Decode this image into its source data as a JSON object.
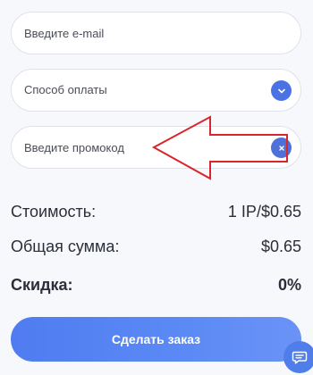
{
  "form": {
    "email_placeholder": "Введите e-mail",
    "payment_method_label": "Способ оплаты",
    "promo_placeholder": "Введите промокод"
  },
  "summary": {
    "cost_label": "Стоимость:",
    "cost_value": "1 IP/$0.65",
    "total_label": "Общая сумма:",
    "total_value": "$0.65",
    "discount_label": "Скидка:",
    "discount_value": "0%"
  },
  "actions": {
    "order_button_label": "Сделать заказ"
  },
  "icons": {
    "dropdown": "chevron-down-icon",
    "clear": "close-icon",
    "chat": "chat-icon"
  },
  "colors": {
    "accent": "#4a72e4",
    "annotation_arrow": "#d9262c",
    "text": "#2b2e38"
  }
}
